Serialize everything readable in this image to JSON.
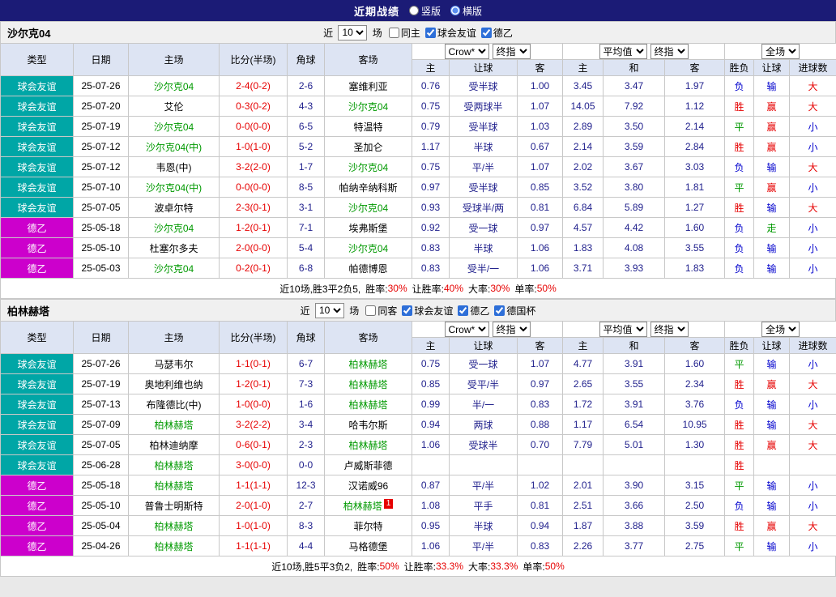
{
  "topbar": {
    "title": "近期战绩",
    "vertical_label": "竖版",
    "horizontal_label": "横版",
    "selected_layout": "横版"
  },
  "colors": {
    "topbar_bg": "#1b1b76",
    "team_highlight": "#009900",
    "score": "#e60000",
    "leagues": {
      "球会友谊": "#00a6a6",
      "德乙": "#cc00cc"
    },
    "outcomes": {
      "胜": "#e60000",
      "负": "#0000cd",
      "平": "#009900",
      "赢": "#e60000",
      "输": "#0000cd",
      "走": "#009900",
      "大": "#e60000",
      "小": "#0000cd"
    }
  },
  "table_headers": {
    "main": [
      "类型",
      "日期",
      "主场",
      "比分(半场)",
      "角球",
      "客场"
    ],
    "sub": [
      "主",
      "让球",
      "客",
      "主",
      "和",
      "客",
      "胜负",
      "让球",
      "进球数"
    ],
    "dropdowns": [
      {
        "name": "odds-source",
        "value": "Crow*"
      },
      {
        "name": "final-odds",
        "value": "终指"
      },
      {
        "name": "average",
        "value": "平均值"
      },
      {
        "name": "final-odds-2",
        "value": "终指"
      },
      {
        "name": "period",
        "value": "全场"
      }
    ]
  },
  "sections": [
    {
      "team": "沙尔克04",
      "filters": {
        "near_label": "近",
        "count": "10",
        "matches_label": "场",
        "same_venue": {
          "label": "同主",
          "checked": false
        },
        "leagues": [
          {
            "label": "球会友谊",
            "checked": true
          },
          {
            "label": "德乙",
            "checked": true
          }
        ]
      },
      "rows": [
        {
          "type": "球会友谊",
          "date": "25-07-26",
          "home": "沙尔克04",
          "score": "2-4(0-2)",
          "corner": "2-6",
          "away": "塞维利亚",
          "odds": [
            "0.76",
            "受半球",
            "1.00"
          ],
          "avg": [
            "3.45",
            "3.47",
            "1.97"
          ],
          "result": "负",
          "cover": "输",
          "goals": "大"
        },
        {
          "type": "球会友谊",
          "date": "25-07-20",
          "home": "艾伦",
          "score": "0-3(0-2)",
          "corner": "4-3",
          "away": "沙尔克04",
          "odds": [
            "0.75",
            "受两球半",
            "1.07"
          ],
          "avg": [
            "14.05",
            "7.92",
            "1.12"
          ],
          "result": "胜",
          "cover": "赢",
          "goals": "大"
        },
        {
          "type": "球会友谊",
          "date": "25-07-19",
          "home": "沙尔克04",
          "score": "0-0(0-0)",
          "corner": "6-5",
          "away": "特温特",
          "odds": [
            "0.79",
            "受半球",
            "1.03"
          ],
          "avg": [
            "2.89",
            "3.50",
            "2.14"
          ],
          "result": "平",
          "cover": "赢",
          "goals": "小"
        },
        {
          "type": "球会友谊",
          "date": "25-07-12",
          "home": "沙尔克04(中)",
          "score": "1-0(1-0)",
          "corner": "5-2",
          "away": "圣加仑",
          "odds": [
            "1.17",
            "半球",
            "0.67"
          ],
          "avg": [
            "2.14",
            "3.59",
            "2.84"
          ],
          "result": "胜",
          "cover": "赢",
          "goals": "小"
        },
        {
          "type": "球会友谊",
          "date": "25-07-12",
          "home": "韦恩(中)",
          "score": "3-2(2-0)",
          "corner": "1-7",
          "away": "沙尔克04",
          "odds": [
            "0.75",
            "平/半",
            "1.07"
          ],
          "avg": [
            "2.02",
            "3.67",
            "3.03"
          ],
          "result": "负",
          "cover": "输",
          "goals": "大"
        },
        {
          "type": "球会友谊",
          "date": "25-07-10",
          "home": "沙尔克04(中)",
          "score": "0-0(0-0)",
          "corner": "8-5",
          "away": "帕纳辛纳科斯",
          "odds": [
            "0.97",
            "受半球",
            "0.85"
          ],
          "avg": [
            "3.52",
            "3.80",
            "1.81"
          ],
          "result": "平",
          "cover": "赢",
          "goals": "小"
        },
        {
          "type": "球会友谊",
          "date": "25-07-05",
          "home": "波卓尔特",
          "score": "2-3(0-1)",
          "corner": "3-1",
          "away": "沙尔克04",
          "odds": [
            "0.93",
            "受球半/两",
            "0.81"
          ],
          "avg": [
            "6.84",
            "5.89",
            "1.27"
          ],
          "result": "胜",
          "cover": "输",
          "goals": "大"
        },
        {
          "type": "德乙",
          "date": "25-05-18",
          "home": "沙尔克04",
          "score": "1-2(0-1)",
          "corner": "7-1",
          "away": "埃弗斯堡",
          "odds": [
            "0.92",
            "受一球",
            "0.97"
          ],
          "avg": [
            "4.57",
            "4.42",
            "1.60"
          ],
          "result": "负",
          "cover": "走",
          "goals": "小"
        },
        {
          "type": "德乙",
          "date": "25-05-10",
          "home": "杜塞尔多夫",
          "score": "2-0(0-0)",
          "corner": "5-4",
          "away": "沙尔克04",
          "odds": [
            "0.83",
            "半球",
            "1.06"
          ],
          "avg": [
            "1.83",
            "4.08",
            "3.55"
          ],
          "result": "负",
          "cover": "输",
          "goals": "小"
        },
        {
          "type": "德乙",
          "date": "25-05-03",
          "home": "沙尔克04",
          "score": "0-2(0-1)",
          "corner": "6-8",
          "away": "帕德博恩",
          "odds": [
            "0.83",
            "受半/一",
            "1.06"
          ],
          "avg": [
            "3.71",
            "3.93",
            "1.83"
          ],
          "result": "负",
          "cover": "输",
          "goals": "小"
        }
      ],
      "summary": {
        "prefix": "近10场,胜3平2负5, ",
        "stats": [
          {
            "label": "胜率:",
            "value": "30%"
          },
          {
            "label": "让胜率:",
            "value": "40%"
          },
          {
            "label": "大率:",
            "value": "30%"
          },
          {
            "label": "单率:",
            "value": "50%"
          }
        ]
      }
    },
    {
      "team": "柏林赫塔",
      "filters": {
        "near_label": "近",
        "count": "10",
        "matches_label": "场",
        "same_venue": {
          "label": "同客",
          "checked": false
        },
        "leagues": [
          {
            "label": "球会友谊",
            "checked": true
          },
          {
            "label": "德乙",
            "checked": true
          },
          {
            "label": "德国杯",
            "checked": true
          }
        ]
      },
      "rows": [
        {
          "type": "球会友谊",
          "date": "25-07-26",
          "home": "马瑟韦尔",
          "score": "1-1(0-1)",
          "corner": "6-7",
          "away": "柏林赫塔",
          "odds": [
            "0.75",
            "受一球",
            "1.07"
          ],
          "avg": [
            "4.77",
            "3.91",
            "1.60"
          ],
          "result": "平",
          "cover": "输",
          "goals": "小"
        },
        {
          "type": "球会友谊",
          "date": "25-07-19",
          "home": "奥地利维也纳",
          "score": "1-2(0-1)",
          "corner": "7-3",
          "away": "柏林赫塔",
          "odds": [
            "0.85",
            "受平/半",
            "0.97"
          ],
          "avg": [
            "2.65",
            "3.55",
            "2.34"
          ],
          "result": "胜",
          "cover": "赢",
          "goals": "大"
        },
        {
          "type": "球会友谊",
          "date": "25-07-13",
          "home": "布隆德比(中)",
          "score": "1-0(0-0)",
          "corner": "1-6",
          "away": "柏林赫塔",
          "odds": [
            "0.99",
            "半/一",
            "0.83"
          ],
          "avg": [
            "1.72",
            "3.91",
            "3.76"
          ],
          "result": "负",
          "cover": "输",
          "goals": "小"
        },
        {
          "type": "球会友谊",
          "date": "25-07-09",
          "home": "柏林赫塔",
          "score": "3-2(2-2)",
          "corner": "3-4",
          "away": "哈韦尔斯",
          "odds": [
            "0.94",
            "两球",
            "0.88"
          ],
          "avg": [
            "1.17",
            "6.54",
            "10.95"
          ],
          "result": "胜",
          "cover": "输",
          "goals": "大"
        },
        {
          "type": "球会友谊",
          "date": "25-07-05",
          "home": "柏林迪纳摩",
          "score": "0-6(0-1)",
          "corner": "2-3",
          "away": "柏林赫塔",
          "odds": [
            "1.06",
            "受球半",
            "0.70"
          ],
          "avg": [
            "7.79",
            "5.01",
            "1.30"
          ],
          "result": "胜",
          "cover": "赢",
          "goals": "大"
        },
        {
          "type": "球会友谊",
          "date": "25-06-28",
          "home": "柏林赫塔",
          "score": "3-0(0-0)",
          "corner": "0-0",
          "away": "卢威斯菲德",
          "odds": [
            "",
            "",
            ""
          ],
          "avg": [
            "",
            "",
            ""
          ],
          "result": "胜",
          "cover": "",
          "goals": ""
        },
        {
          "type": "德乙",
          "date": "25-05-18",
          "home": "柏林赫塔",
          "score": "1-1(1-1)",
          "corner": "12-3",
          "away": "汉诺威96",
          "odds": [
            "0.87",
            "平/半",
            "1.02"
          ],
          "avg": [
            "2.01",
            "3.90",
            "3.15"
          ],
          "result": "平",
          "cover": "输",
          "goals": "小"
        },
        {
          "type": "德乙",
          "date": "25-05-10",
          "home": "普鲁士明斯特",
          "score": "2-0(1-0)",
          "corner": "2-7",
          "away": "柏林赫塔",
          "away_card": "1",
          "odds": [
            "1.08",
            "平手",
            "0.81"
          ],
          "avg": [
            "2.51",
            "3.66",
            "2.50"
          ],
          "result": "负",
          "cover": "输",
          "goals": "小"
        },
        {
          "type": "德乙",
          "date": "25-05-04",
          "home": "柏林赫塔",
          "score": "1-0(1-0)",
          "corner": "8-3",
          "away": "菲尔特",
          "odds": [
            "0.95",
            "半球",
            "0.94"
          ],
          "avg": [
            "1.87",
            "3.88",
            "3.59"
          ],
          "result": "胜",
          "cover": "赢",
          "goals": "大"
        },
        {
          "type": "德乙",
          "date": "25-04-26",
          "home": "柏林赫塔",
          "score": "1-1(1-1)",
          "corner": "4-4",
          "away": "马格德堡",
          "odds": [
            "1.06",
            "平/半",
            "0.83"
          ],
          "avg": [
            "2.26",
            "3.77",
            "2.75"
          ],
          "result": "平",
          "cover": "输",
          "goals": "小"
        }
      ],
      "summary": {
        "prefix": "近10场,胜5平3负2, ",
        "stats": [
          {
            "label": "胜率:",
            "value": "50%"
          },
          {
            "label": "让胜率:",
            "value": "33.3%"
          },
          {
            "label": "大率:",
            "value": "33.3%"
          },
          {
            "label": "单率:",
            "value": "50%"
          }
        ]
      }
    }
  ]
}
